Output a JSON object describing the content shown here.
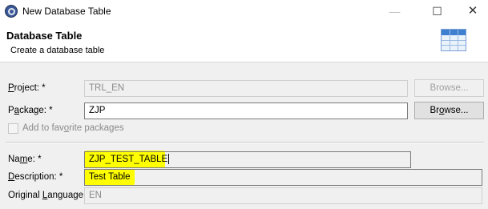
{
  "window": {
    "title": "New Database Table",
    "min_glyph": "—",
    "max_glyph": "☐",
    "close_glyph": "✕"
  },
  "header": {
    "title": "Database Table",
    "subtitle": "Create a database table",
    "icon": "table-icon"
  },
  "form": {
    "project": {
      "label_pre": "",
      "label_u": "P",
      "label_post": "roject: *",
      "value": "TRL_EN",
      "browse_label": "Browse...",
      "enabled": false
    },
    "package": {
      "label_pre": "P",
      "label_u": "a",
      "label_post": "ckage: *",
      "value": "ZJP",
      "browse_label_pre": "Br",
      "browse_label_u": "o",
      "browse_label_post": "wse...",
      "enabled": true
    },
    "favorite": {
      "label_pre": "Add to fav",
      "label_u": "o",
      "label_post": "rite packages",
      "checked": false,
      "enabled": false
    },
    "name": {
      "label_pre": "Na",
      "label_u": "m",
      "label_post": "e: *",
      "value": "ZJP_TEST_TABLE"
    },
    "description": {
      "label_pre": "",
      "label_u": "D",
      "label_post": "escription: *",
      "value": "Test Table"
    },
    "original_language": {
      "label_pre": "Original ",
      "label_u": "L",
      "label_post": "anguage:",
      "value": "EN"
    }
  },
  "colors": {
    "highlight": "#ffff00",
    "window_bg": "#f0f0f0"
  }
}
